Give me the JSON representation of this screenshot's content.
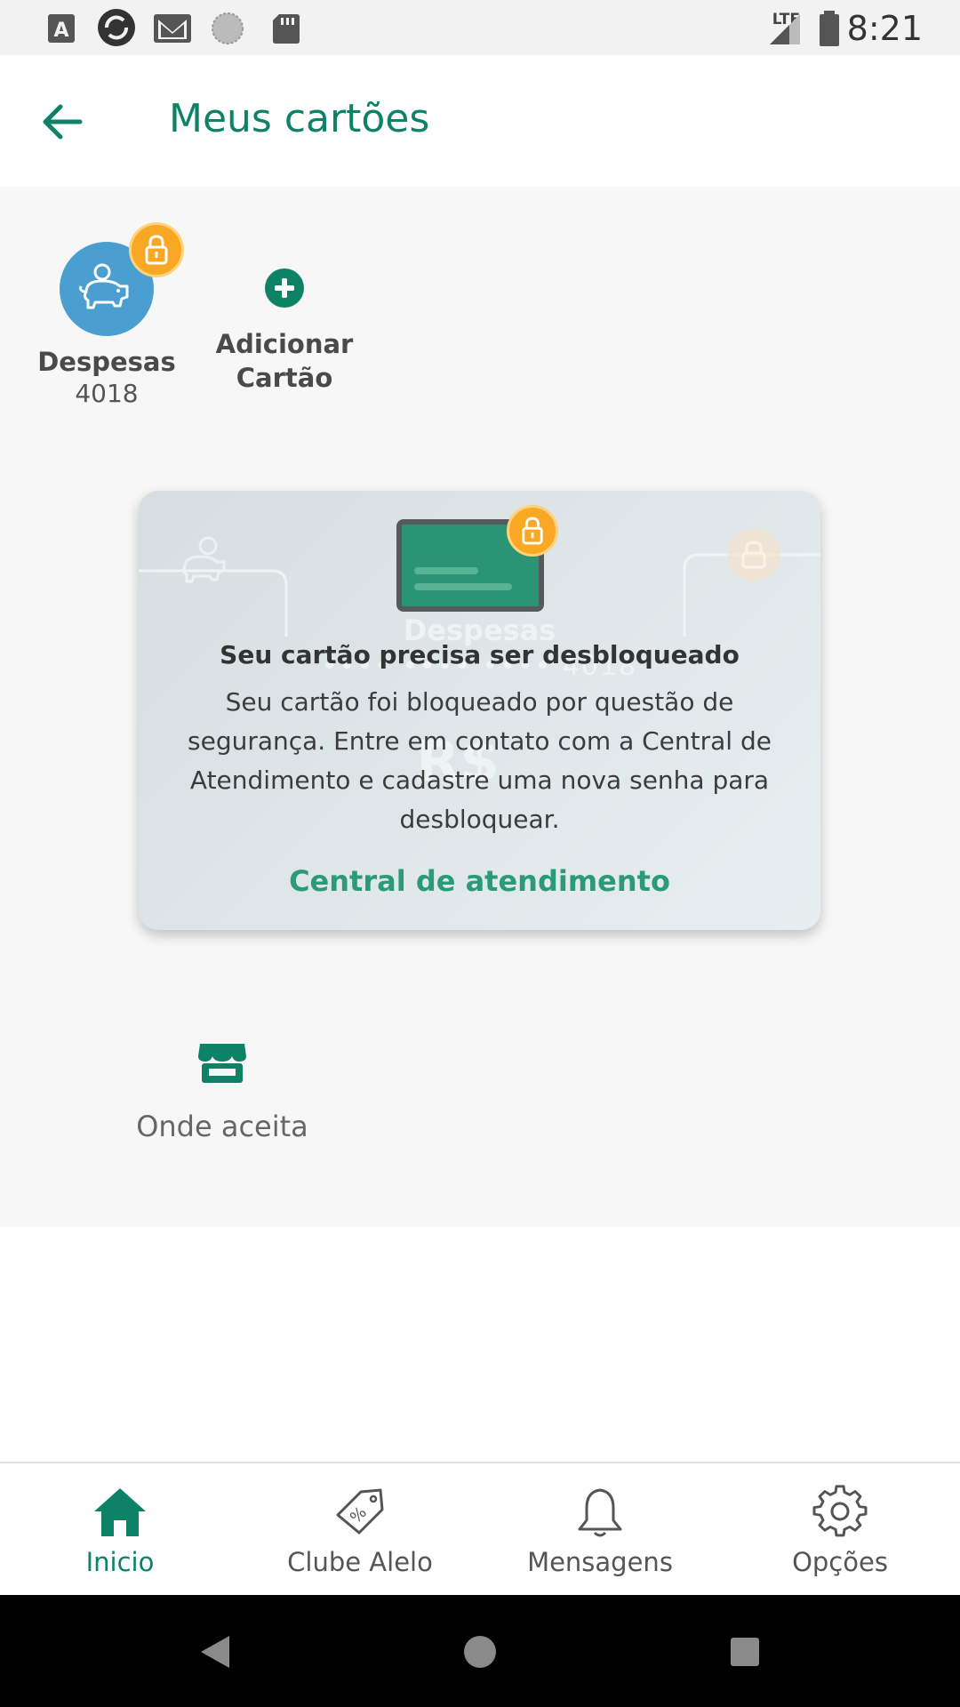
{
  "status_bar": {
    "time": "8:21",
    "network": "LTE",
    "icons": [
      "a-icon",
      "sync-icon",
      "gmail-icon",
      "circle-icon",
      "sd-card-icon"
    ]
  },
  "header": {
    "title": "Meus cartões",
    "back_icon": "arrow-left-icon"
  },
  "cards": [
    {
      "name": "Despesas",
      "number": "4018",
      "icon": "piggy-bank-icon",
      "locked": true
    }
  ],
  "add_card": {
    "label": "Adicionar Cartão",
    "icon": "plus-circle-icon"
  },
  "blocked_card": {
    "background_name": "Despesas",
    "background_number": "•••• •••• •••• 4018",
    "background_balance": "R$",
    "title": "Seu cartão precisa ser desbloqueado",
    "message": "Seu cartão foi bloqueado por questão de segurança. Entre em contato com a Central de Atendimento e cadastre uma nova senha para desbloquear.",
    "link_label": "Central de atendimento"
  },
  "onde_aceita": {
    "label": "Onde aceita",
    "icon": "store-icon"
  },
  "bottom_nav": {
    "items": [
      {
        "label": "Inicio",
        "icon": "home-icon",
        "active": true
      },
      {
        "label": "Clube Alelo",
        "icon": "discount-tag-icon",
        "active": false
      },
      {
        "label": "Mensagens",
        "icon": "bell-icon",
        "active": false
      },
      {
        "label": "Opções",
        "icon": "gear-icon",
        "active": false
      }
    ]
  },
  "colors": {
    "primary": "#0e8266",
    "link": "#2b9a76",
    "lock_badge": "#f9a825",
    "avatar": "#4a9fd0",
    "card_panel": "#dfe7ea"
  }
}
